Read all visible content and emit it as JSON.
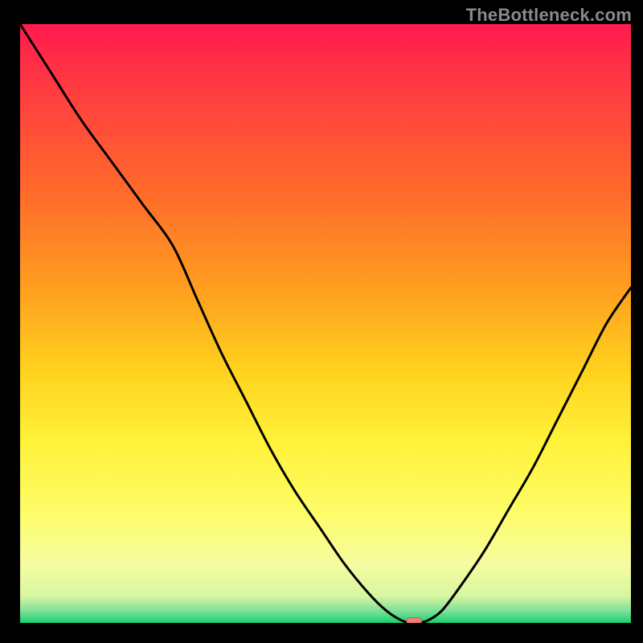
{
  "watermark": {
    "text": "TheBottleneck.com"
  },
  "colors": {
    "background": "#000000",
    "curve": "#000000",
    "marker_fill": "#f08078",
    "marker_stroke": "#d06058",
    "gradient_stops": [
      {
        "offset": 0.0,
        "color": "#ff1a4e"
      },
      {
        "offset": 0.12,
        "color": "#ff3f3f"
      },
      {
        "offset": 0.28,
        "color": "#ff6a2a"
      },
      {
        "offset": 0.44,
        "color": "#ff9e1f"
      },
      {
        "offset": 0.58,
        "color": "#ffd21e"
      },
      {
        "offset": 0.7,
        "color": "#fff23a"
      },
      {
        "offset": 0.82,
        "color": "#fdfd6a"
      },
      {
        "offset": 0.9,
        "color": "#f6fca0"
      },
      {
        "offset": 0.955,
        "color": "#d8f6a0"
      },
      {
        "offset": 0.98,
        "color": "#7ee098"
      },
      {
        "offset": 1.0,
        "color": "#18d070"
      }
    ]
  },
  "chart_data": {
    "type": "line",
    "title": "",
    "xlabel": "",
    "ylabel": "",
    "xlim": [
      0,
      100
    ],
    "ylim": [
      0,
      100
    ],
    "categories_note": "x is normalized position across the plot (0 left, 100 right); y estimated from vertical position (0 bottom, 100 top)",
    "series": [
      {
        "name": "bottleneck-curve",
        "x": [
          0,
          5,
          10,
          15,
          20,
          25,
          29,
          33,
          37,
          41,
          45,
          49,
          53,
          57,
          60,
          62.7,
          64.5,
          66.5,
          69,
          72,
          76,
          80,
          84,
          88,
          92,
          96,
          100
        ],
        "y": [
          100,
          92,
          84,
          77,
          70,
          63,
          54,
          45,
          37,
          29,
          22,
          16,
          10,
          5,
          2,
          0.3,
          0.0,
          0.3,
          2,
          6,
          12,
          19,
          26,
          34,
          42,
          50,
          56
        ]
      }
    ],
    "marker": {
      "name": "optimal-point",
      "x": 64.5,
      "y": 0.2
    }
  }
}
